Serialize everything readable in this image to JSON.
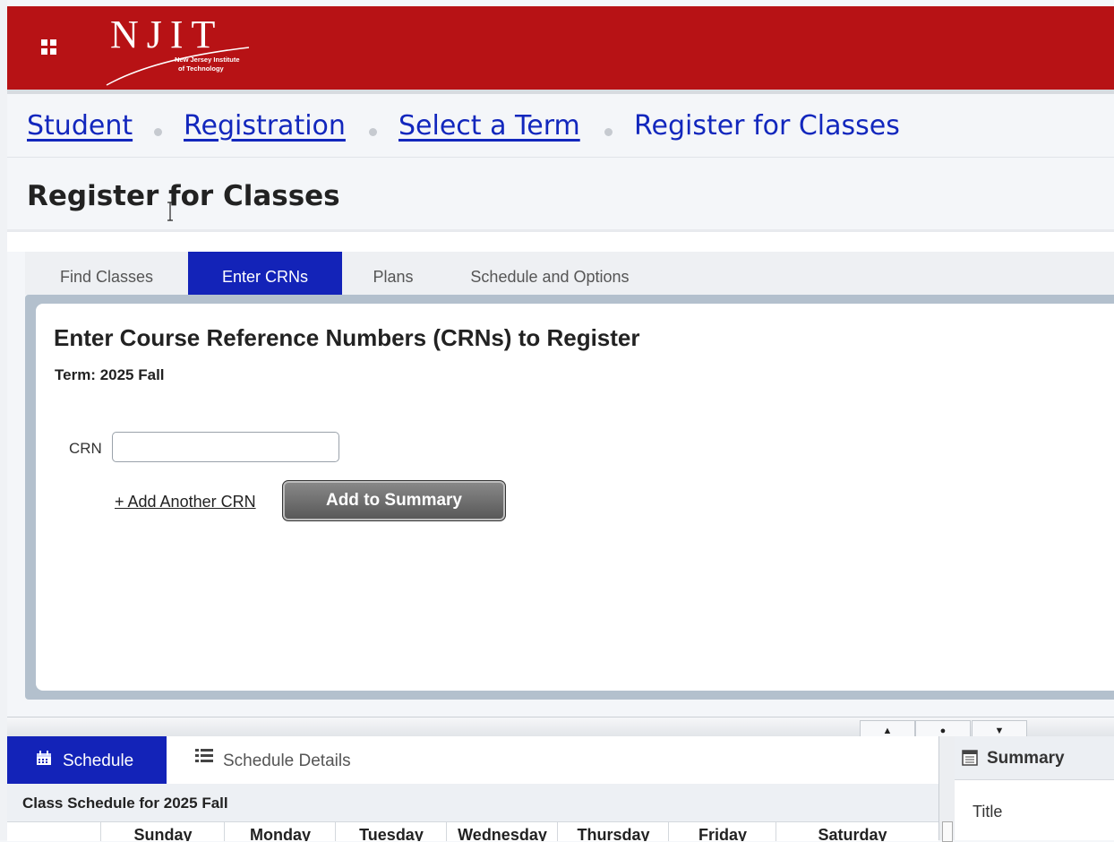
{
  "header": {
    "logo_letters": "NJIT",
    "logo_sub_1": "New Jersey Institute",
    "logo_sub_2": "of Technology"
  },
  "breadcrumb": [
    "Student",
    "Registration",
    "Select a Term",
    "Register for Classes"
  ],
  "page_title": "Register for Classes",
  "tabs": [
    "Find Classes",
    "Enter CRNs",
    "Plans",
    "Schedule and Options"
  ],
  "active_tab": "Enter CRNs",
  "panel": {
    "heading": "Enter Course Reference Numbers (CRNs) to Register",
    "term": "Term: 2025 Fall",
    "crn_label": "CRN",
    "crn_value": "",
    "add_link": "+ Add Another CRN",
    "add_button": "Add to Summary"
  },
  "bottom": {
    "tabs": [
      "Schedule",
      "Schedule Details"
    ],
    "schedule_title": "Class Schedule for 2025 Fall",
    "days": [
      "Sunday",
      "Monday",
      "Tuesday",
      "Wednesday",
      "Thursday",
      "Friday",
      "Saturday"
    ],
    "summary_title": "Summary",
    "summary_column": "Title"
  },
  "colors": {
    "header_red": "#b71215",
    "accent_blue": "#1323b8",
    "link_blue": "#1227bd"
  },
  "icons": [
    "app-grid-icon",
    "calendar-icon",
    "list-icon",
    "summary-icon",
    "text-cursor-icon",
    "up-arrow-icon",
    "center-dot-icon",
    "down-arrow-icon"
  ]
}
